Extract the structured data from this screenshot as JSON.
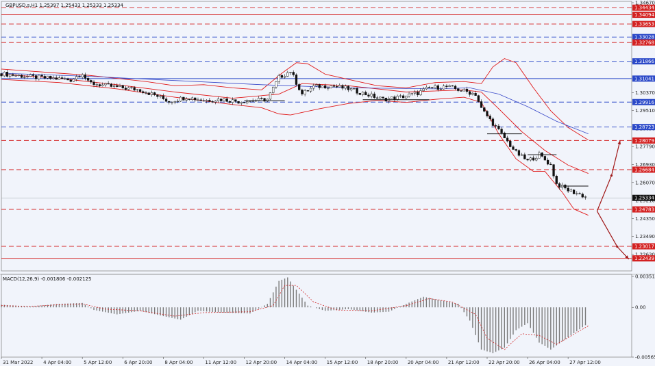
{
  "chart_data": [
    {
      "type": "candlestick",
      "title": "GBPUSD.s,H1  1.25397 1.25433 1.25333 1.25334",
      "ylim": [
        1.2184,
        1.3467
      ],
      "y_ticks": [
        "1.34670",
        "1.31810",
        "1.30370",
        "1.29510",
        "1.28650",
        "1.27790",
        "1.26930",
        "1.26070",
        "1.25210",
        "1.24350",
        "1.23490",
        "1.22630"
      ],
      "y_tick_values": [
        1.3467,
        1.3181,
        1.3037,
        1.2951,
        1.2865,
        1.2779,
        1.2693,
        1.2607,
        1.2521,
        1.2435,
        1.2349,
        1.2263
      ],
      "x_ticks": [
        "31 Mar 2022",
        "4 Apr 04:00",
        "5 Apr 12:00",
        "6 Apr 20:00",
        "8 Apr 04:00",
        "11 Apr 12:00",
        "12 Apr 20:00",
        "14 Apr 04:00",
        "15 Apr 12:00",
        "18 Apr 20:00",
        "20 Apr 04:00",
        "21 Apr 12:00",
        "22 Apr 20:00",
        "26 Apr 04:00",
        "27 Apr 12:00"
      ],
      "x_tick_index": [
        0,
        14,
        28,
        42,
        56,
        70,
        84,
        98,
        112,
        126,
        140,
        154,
        168,
        182,
        196
      ],
      "bar_count": 203,
      "current_price": "1.25334",
      "current_price_value": 1.25334,
      "levels": [
        {
          "label": "1.34434",
          "value": 1.34434,
          "color": "#d32020",
          "style": "dashed"
        },
        {
          "label": "1.34094",
          "value": 1.34094,
          "color": "#d32020",
          "style": "solid"
        },
        {
          "label": "1.33653",
          "value": 1.33653,
          "color": "#d32020",
          "style": "dashed"
        },
        {
          "label": "1.33028",
          "value": 1.33028,
          "color": "#2a48c8",
          "style": "dashed"
        },
        {
          "label": "1.32768",
          "value": 1.32768,
          "color": "#d32020",
          "style": "dashed"
        },
        {
          "label": "1.31866",
          "value": 1.31866,
          "color": "#2a48c8",
          "style": "dashed"
        },
        {
          "label": "1.31041",
          "value": 1.31041,
          "color": "#2a48c8",
          "style": "solid"
        },
        {
          "label": "1.29916",
          "value": 1.29916,
          "color": "#2a48c8",
          "style": "dashed"
        },
        {
          "label": "1.28723",
          "value": 1.28723,
          "color": "#2a48c8",
          "style": "dashed"
        },
        {
          "label": "1.28079",
          "value": 1.28079,
          "color": "#d32020",
          "style": "dashed"
        },
        {
          "label": "1.26684",
          "value": 1.26684,
          "color": "#d32020",
          "style": "dashed"
        },
        {
          "label": "1.24783",
          "value": 1.24783,
          "color": "#d32020",
          "style": "dashed"
        },
        {
          "label": "1.23017",
          "value": 1.23017,
          "color": "#d32020",
          "style": "dashed"
        },
        {
          "label": "1.22439",
          "value": 1.22439,
          "color": "#d32020",
          "style": "solid"
        }
      ],
      "close_path": [
        [
          0,
          1.3128
        ],
        [
          6,
          1.3118
        ],
        [
          12,
          1.311
        ],
        [
          18,
          1.3105
        ],
        [
          24,
          1.3098
        ],
        [
          28,
          1.313
        ],
        [
          30,
          1.3085
        ],
        [
          36,
          1.307
        ],
        [
          42,
          1.306
        ],
        [
          48,
          1.305
        ],
        [
          54,
          1.302
        ],
        [
          58,
          1.2995
        ],
        [
          64,
          1.3015
        ],
        [
          70,
          1.3
        ],
        [
          76,
          1.3005
        ],
        [
          82,
          1.2995
        ],
        [
          88,
          1.3
        ],
        [
          92,
          1.3005
        ],
        [
          96,
          1.311
        ],
        [
          100,
          1.314
        ],
        [
          104,
          1.303
        ],
        [
          108,
          1.3065
        ],
        [
          114,
          1.307
        ],
        [
          120,
          1.3055
        ],
        [
          126,
          1.303
        ],
        [
          132,
          1.3005
        ],
        [
          138,
          1.3015
        ],
        [
          144,
          1.3035
        ],
        [
          148,
          1.306
        ],
        [
          154,
          1.3065
        ],
        [
          160,
          1.3045
        ],
        [
          164,
          1.303
        ],
        [
          166,
          1.296
        ],
        [
          170,
          1.289
        ],
        [
          174,
          1.282
        ],
        [
          178,
          1.275
        ],
        [
          182,
          1.271
        ],
        [
          186,
          1.274
        ],
        [
          190,
          1.269
        ],
        [
          192,
          1.26
        ],
        [
          196,
          1.257
        ],
        [
          200,
          1.255
        ],
        [
          203,
          1.2533
        ]
      ],
      "bollinger_upper": [
        [
          0,
          1.315
        ],
        [
          10,
          1.314
        ],
        [
          20,
          1.313
        ],
        [
          30,
          1.312
        ],
        [
          40,
          1.3105
        ],
        [
          50,
          1.309
        ],
        [
          60,
          1.307
        ],
        [
          70,
          1.3075
        ],
        [
          80,
          1.306
        ],
        [
          90,
          1.305
        ],
        [
          97,
          1.313
        ],
        [
          102,
          1.318
        ],
        [
          106,
          1.3175
        ],
        [
          112,
          1.3125
        ],
        [
          120,
          1.31
        ],
        [
          130,
          1.307
        ],
        [
          140,
          1.306
        ],
        [
          150,
          1.3085
        ],
        [
          160,
          1.309
        ],
        [
          166,
          1.308
        ],
        [
          170,
          1.316
        ],
        [
          174,
          1.32
        ],
        [
          178,
          1.318
        ],
        [
          184,
          1.306
        ],
        [
          190,
          1.295
        ],
        [
          196,
          1.287
        ],
        [
          203,
          1.281
        ]
      ],
      "bollinger_middle": [
        [
          0,
          1.3125
        ],
        [
          20,
          1.3105
        ],
        [
          40,
          1.3075
        ],
        [
          60,
          1.304
        ],
        [
          80,
          1.301
        ],
        [
          96,
          1.303
        ],
        [
          104,
          1.308
        ],
        [
          120,
          1.307
        ],
        [
          140,
          1.304
        ],
        [
          160,
          1.305
        ],
        [
          166,
          1.304
        ],
        [
          172,
          1.296
        ],
        [
          180,
          1.285
        ],
        [
          188,
          1.276
        ],
        [
          196,
          1.269
        ],
        [
          203,
          1.265
        ]
      ],
      "bollinger_lower": [
        [
          0,
          1.31
        ],
        [
          20,
          1.3085
        ],
        [
          40,
          1.3055
        ],
        [
          60,
          1.3015
        ],
        [
          80,
          1.298
        ],
        [
          90,
          1.2965
        ],
        [
          96,
          1.2935
        ],
        [
          100,
          1.293
        ],
        [
          110,
          1.296
        ],
        [
          120,
          1.2985
        ],
        [
          130,
          1.3
        ],
        [
          140,
          1.299
        ],
        [
          150,
          1.3005
        ],
        [
          160,
          1.3015
        ],
        [
          166,
          1.299
        ],
        [
          172,
          1.284
        ],
        [
          178,
          1.272
        ],
        [
          184,
          1.266
        ],
        [
          188,
          1.266
        ],
        [
          194,
          1.256
        ],
        [
          198,
          1.248
        ],
        [
          203,
          1.245
        ]
      ],
      "moving_average": [
        [
          0,
          1.313
        ],
        [
          30,
          1.3115
        ],
        [
          60,
          1.3095
        ],
        [
          90,
          1.3075
        ],
        [
          120,
          1.306
        ],
        [
          150,
          1.3055
        ],
        [
          162,
          1.306
        ],
        [
          172,
          1.303
        ],
        [
          182,
          1.297
        ],
        [
          192,
          1.29
        ],
        [
          203,
          1.284
        ]
      ],
      "support_resistance_segments": [
        {
          "x0": 84,
          "x1": 98,
          "y": 1.2998
        },
        {
          "x0": 125,
          "x1": 148,
          "y": 1.3003
        },
        {
          "x0": 168,
          "x1": 180,
          "y": 1.284
        },
        {
          "x0": 182,
          "x1": 192,
          "y": 1.274
        },
        {
          "x0": 194,
          "x1": 203,
          "y": 1.259
        }
      ],
      "projection_arrows": [
        {
          "points": [
            [
              206,
              1.247
            ],
            [
              211,
              1.264
            ],
            [
              214,
              1.2808
            ]
          ],
          "color": "#a01818"
        },
        {
          "points": [
            [
              206,
              1.247
            ],
            [
              213,
              1.23
            ],
            [
              217,
              1.224
            ]
          ],
          "color": "#a01818"
        }
      ],
      "grid": false
    },
    {
      "type": "bar",
      "title": "MACD(12,26,9) -0.001806 -0.002125",
      "ylim": [
        -0.005654,
        0.003515
      ],
      "y_ticks": [
        "0.003515",
        "0.00",
        "-0.005654"
      ],
      "y_tick_values": [
        0.003515,
        0.0,
        -0.005654
      ],
      "macd_histogram": [
        [
          0,
          0.0003
        ],
        [
          10,
          0.0001
        ],
        [
          20,
          0.0004
        ],
        [
          28,
          0.0005
        ],
        [
          32,
          -0.0003
        ],
        [
          40,
          -0.0008
        ],
        [
          48,
          -0.0004
        ],
        [
          56,
          -0.001
        ],
        [
          62,
          -0.0014
        ],
        [
          68,
          -0.0004
        ],
        [
          76,
          -0.0006
        ],
        [
          86,
          -0.0007
        ],
        [
          92,
          0.0004
        ],
        [
          96,
          0.003
        ],
        [
          99,
          0.0034
        ],
        [
          102,
          0.002
        ],
        [
          106,
          0.0002
        ],
        [
          112,
          -0.0004
        ],
        [
          120,
          -0.0002
        ],
        [
          128,
          -0.0006
        ],
        [
          134,
          -0.0005
        ],
        [
          140,
          0.0004
        ],
        [
          146,
          0.0012
        ],
        [
          152,
          0.0008
        ],
        [
          158,
          0.0004
        ],
        [
          162,
          -0.0015
        ],
        [
          166,
          -0.0048
        ],
        [
          170,
          -0.0052
        ],
        [
          174,
          -0.0046
        ],
        [
          178,
          -0.0026
        ],
        [
          182,
          -0.0018
        ],
        [
          186,
          -0.004
        ],
        [
          190,
          -0.0048
        ],
        [
          196,
          -0.0034
        ],
        [
          203,
          -0.0018
        ]
      ],
      "signal_line": [
        [
          0,
          0.0002
        ],
        [
          10,
          0.0001
        ],
        [
          20,
          0.0003
        ],
        [
          28,
          0.0004
        ],
        [
          36,
          -0.0002
        ],
        [
          48,
          -0.0004
        ],
        [
          60,
          -0.001
        ],
        [
          70,
          -0.0006
        ],
        [
          86,
          -0.0005
        ],
        [
          94,
          0.0002
        ],
        [
          98,
          0.0025
        ],
        [
          102,
          0.0025
        ],
        [
          108,
          0.0006
        ],
        [
          116,
          -0.0003
        ],
        [
          128,
          -0.0004
        ],
        [
          140,
          0.0002
        ],
        [
          148,
          0.001
        ],
        [
          156,
          0.0006
        ],
        [
          164,
          -0.0008
        ],
        [
          168,
          -0.0035
        ],
        [
          174,
          -0.0048
        ],
        [
          180,
          -0.003
        ],
        [
          186,
          -0.0032
        ],
        [
          192,
          -0.0042
        ],
        [
          203,
          -0.0021
        ]
      ]
    }
  ]
}
